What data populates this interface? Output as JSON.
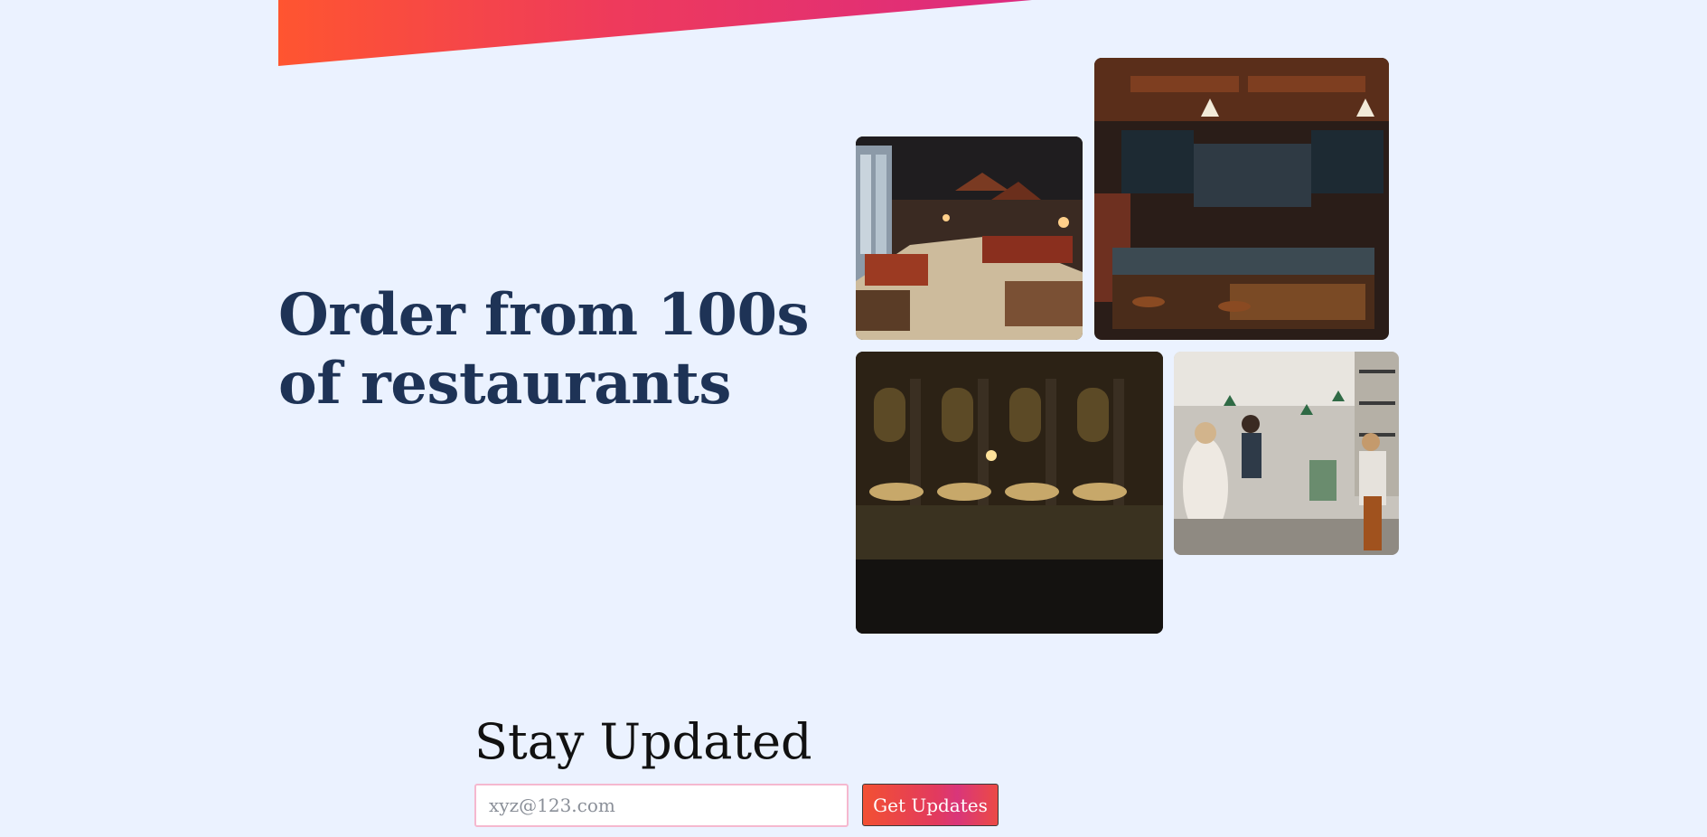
{
  "hero": {
    "headline": "Order from 100s of restaurants",
    "images": [
      {
        "name": "restaurant-interior-photo",
        "alt": ""
      },
      {
        "name": "bar-counter-photo",
        "alt": ""
      },
      {
        "name": "outdoor-dining-photo",
        "alt": ""
      },
      {
        "name": "busy-cafe-photo",
        "alt": ""
      }
    ]
  },
  "newsletter": {
    "title": "Stay Updated",
    "email_placeholder": "xyz@123.com",
    "email_value": "",
    "button_label": "Get Updates"
  },
  "colors": {
    "background": "#ebf2ff",
    "headline": "#1e3356",
    "accent_start": "#ff5530",
    "accent_end": "#dc2a80",
    "input_border": "#f5b8cf"
  }
}
